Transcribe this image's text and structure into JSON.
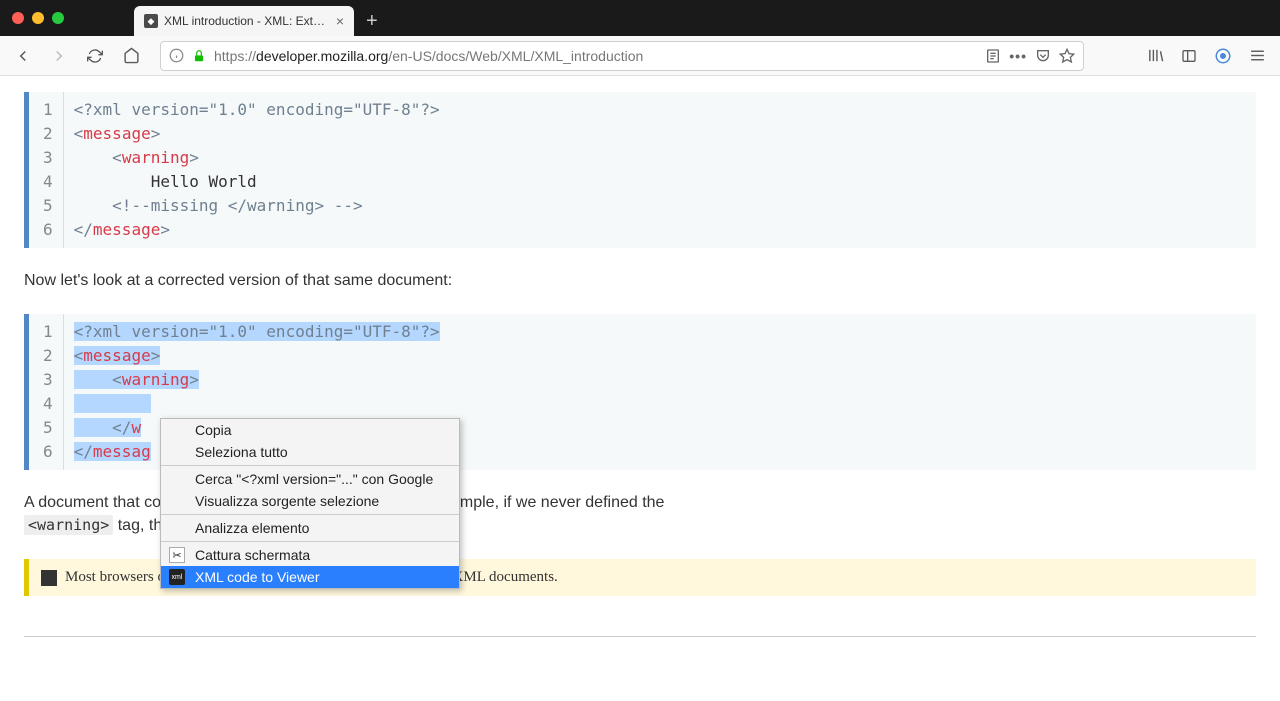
{
  "window": {
    "tab_title": "XML introduction - XML: Extens"
  },
  "url": {
    "scheme": "https://",
    "domain": "developer.mozilla.org",
    "path": "/en-US/docs/Web/XML/XML_introduction"
  },
  "code1": {
    "gutters": [
      "1",
      "2",
      "3",
      "4",
      "5",
      "6"
    ],
    "line1": "<?xml version=\"1.0\" encoding=\"UTF-8\"?>",
    "line2_open": "<",
    "line2_tag": "message",
    "line2_close": ">",
    "line3_indent": "    <",
    "line3_tag": "warning",
    "line3_close": ">",
    "line4": "        Hello World",
    "line5": "    <!--missing </warning> -->",
    "line6_open": "</",
    "line6_tag": "message",
    "line6_close": ">"
  },
  "prose1": "Now let's look at a corrected version of that same document:",
  "code2": {
    "gutters": [
      "1",
      "2",
      "3",
      "4",
      "5",
      "6"
    ],
    "line1": "<?xml version=\"1.0\" encoding=\"UTF-8\"?>",
    "line2_open": "<",
    "line2_tag": "message",
    "line2_close": ">",
    "line3_indent": "    <",
    "line3_tag": "warning",
    "line3_close": ">",
    "line4": "        ",
    "line5_indent": "    </",
    "line5_tag": "w",
    "line6_open": "</",
    "line6_tag": "messag"
  },
  "prose2_before": "A document that co",
  "prose2_after": "mple, if we never defined the ",
  "prose2_code": "<warning>",
  "prose2_tail": " tag, th",
  "note": "Most browsers offer a debugger that can identify poorly-formed XML documents.",
  "context_menu": {
    "copy": "Copia",
    "select_all": "Seleziona tutto",
    "search": "Cerca \"<?xml version=\"...\" con Google",
    "view_source": "Visualizza sorgente selezione",
    "inspect": "Analizza elemento",
    "screenshot": "Cattura schermata",
    "xml_viewer": "XML code to Viewer"
  }
}
